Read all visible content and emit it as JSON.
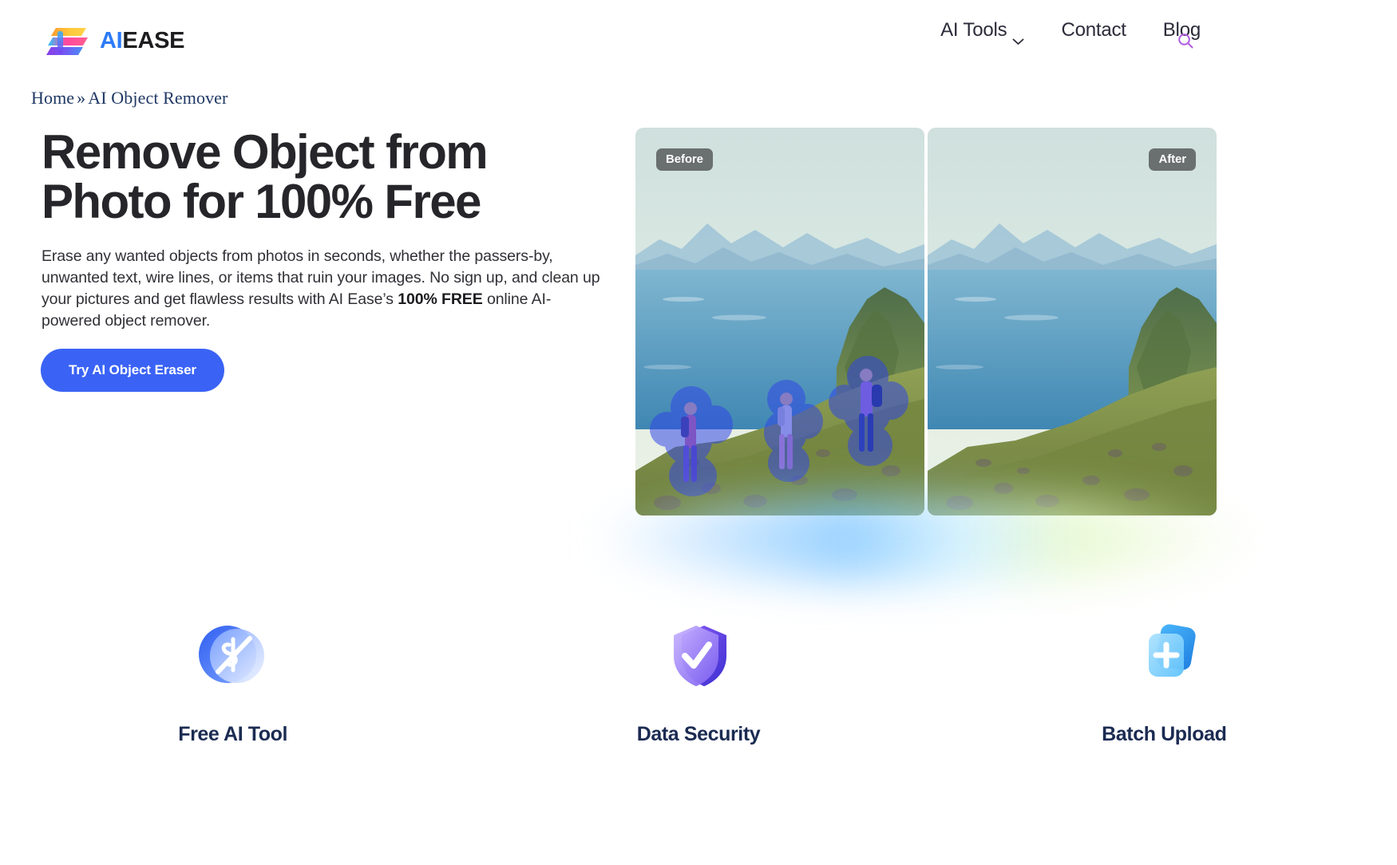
{
  "header": {
    "logo": {
      "mark_name": "aiease-logo-mark",
      "text_primary": "AI",
      "text_secondary": "EASE",
      "colors": {
        "ai": "#2e7bf6",
        "ease": "#1d1d1f"
      }
    },
    "nav": [
      {
        "label": "AI Tools",
        "has_dropdown": true,
        "icon": "chevron-down-icon"
      },
      {
        "label": "Contact",
        "has_dropdown": false
      },
      {
        "label": "Blog",
        "has_dropdown": false
      }
    ],
    "search": {
      "icon": "search-icon",
      "color": "#b05ce0"
    }
  },
  "breadcrumb": {
    "home": "Home",
    "separator": "»",
    "current": "AI Object Remover"
  },
  "hero": {
    "title_line1": "Remove Object from",
    "title_line2": "Photo for 100% Free",
    "description_part1": "Erase any wanted objects from photos in seconds, whether the passers-by, unwanted text, wire lines, or items that ruin your images. No sign up, and clean up your pictures and get flawless results with AI Ease’s ",
    "description_bold": "100% FREE",
    "description_part2": " online AI-powered object remover.",
    "cta_label": "Try AI Object Eraser",
    "cta_color": "#3a63f5"
  },
  "comparison": {
    "before_badge": "Before",
    "after_badge": "After",
    "before_alt": "hikers-on-mountain-ridge-with-blue-selection-mask",
    "after_alt": "mountain-ridge-with-hikers-removed"
  },
  "features": [
    {
      "icon": "free-dollar-icon",
      "label": "Free AI Tool",
      "color": "#3f63f0"
    },
    {
      "icon": "shield-check-icon",
      "label": "Data Security",
      "color": "#6b4bf0"
    },
    {
      "icon": "batch-upload-icon",
      "label": "Batch Upload",
      "color": "#3fa9f5"
    }
  ]
}
